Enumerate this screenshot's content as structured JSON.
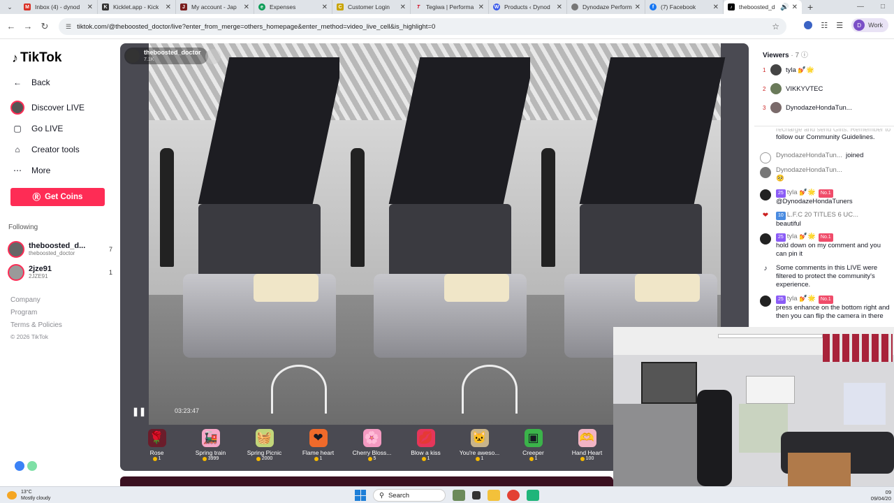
{
  "browser": {
    "tabs": [
      {
        "label": "Inbox (4) - dynod",
        "fav_color": "#d93025",
        "icon": "gmail-icon"
      },
      {
        "label": "Kicklet.app - Kick",
        "fav_color": "#333333",
        "icon": "kicklet-icon"
      },
      {
        "label": "My account - Jap",
        "fav_color": "#7a1d1d",
        "icon": "japan-icon"
      },
      {
        "label": "Expenses",
        "fav_color": "#0f9d58",
        "icon": "expenses-icon"
      },
      {
        "label": "Customer Login",
        "fav_color": "#c9a400",
        "icon": "login-icon"
      },
      {
        "label": "Tegiwa | Performa",
        "fav_color": "#d0021b",
        "icon": "tegiwa-icon"
      },
      {
        "label": "Products ‹ Dynod",
        "fav_color": "#3858e9",
        "icon": "wordpress-icon"
      },
      {
        "label": "Dynodaze Perform",
        "fav_color": "#555555",
        "icon": "globe-icon"
      },
      {
        "label": "(7) Facebook",
        "fav_color": "#1877f2",
        "icon": "facebook-icon"
      },
      {
        "label": "theboosted_d",
        "fav_color": "#000000",
        "icon": "tiktok-icon",
        "active": true
      }
    ],
    "url": "tiktok.com/@theboosted_doctor/live?enter_from_merge=others_homepage&enter_method=video_live_cell&is_highlight=0",
    "profile_initial": "D",
    "profile_name": "Work"
  },
  "sidebar": {
    "logo": "TikTok",
    "nav": [
      {
        "label": "Back",
        "icon": "back-arrow-icon"
      },
      {
        "label": "Discover LIVE",
        "icon": "discover-live-icon"
      },
      {
        "label": "Go LIVE",
        "icon": "camera-icon"
      },
      {
        "label": "Creator tools",
        "icon": "creator-tools-icon"
      },
      {
        "label": "More",
        "icon": "more-icon"
      }
    ],
    "get_coins": "Get Coins",
    "following_label": "Following",
    "following": [
      {
        "name": "theboosted_d...",
        "handle": "theboosted_doctor",
        "count": "7"
      },
      {
        "name": "2jze91",
        "handle": "2JZE91",
        "count": "1"
      }
    ],
    "footer": {
      "company": "Company",
      "program": "Program",
      "terms": "Terms & Policies",
      "copyright": "© 2026 TikTok"
    }
  },
  "video": {
    "streamer": "theboosted_doctor",
    "viewer_count": "7.1K",
    "elapsed": "03:23:47",
    "gifts": [
      {
        "name": "Rose",
        "price": "1",
        "glyph": "🌹",
        "color": "#6b1d2b"
      },
      {
        "name": "Spring train",
        "price": "3999",
        "glyph": "🚂",
        "color": "#f7a7c8"
      },
      {
        "name": "Spring Picnic",
        "price": "2000",
        "glyph": "🧺",
        "color": "#c2d67a"
      },
      {
        "name": "Flame heart",
        "price": "1",
        "glyph": "❤",
        "color": "#f06a2a"
      },
      {
        "name": "Cherry Bloss...",
        "price": "5",
        "glyph": "🌸",
        "color": "#f49ac1"
      },
      {
        "name": "Blow a kiss",
        "price": "1",
        "glyph": "💋",
        "color": "#e5365a"
      },
      {
        "name": "You're aweso...",
        "price": "1",
        "glyph": "🐱",
        "color": "#c9b48a"
      },
      {
        "name": "Creeper",
        "price": "1",
        "glyph": "▣",
        "color": "#3bb34a"
      },
      {
        "name": "Hand Heart",
        "price": "100",
        "glyph": "🫶",
        "color": "#f2b4c4"
      }
    ]
  },
  "viewers": {
    "title": "Viewers",
    "count": "· 7",
    "list": [
      {
        "rank": "1",
        "name": "tyla 💅🌟"
      },
      {
        "rank": "2",
        "name": "VIKKYVTEC"
      },
      {
        "rank": "3",
        "name": "DynodazeHondaTun..."
      }
    ]
  },
  "chat": {
    "notice_cut": "recharge and send Gifts. Remember to",
    "notice_rest": "follow our Community Guidelines.",
    "messages": [
      {
        "user": "DynodazeHondaTun...",
        "text": "joined"
      },
      {
        "user": "DynodazeHondaTun...",
        "text": "🥺"
      },
      {
        "badge": "25",
        "user": "tyla 💅🌟",
        "rank_badge": "No.1",
        "text": "@DynodazeHondaTuners"
      },
      {
        "badge": "10",
        "user": "L.F.C 20 TITLES 6 UC...",
        "text": "beautiful"
      },
      {
        "badge": "25",
        "user": "tyla 💅🌟",
        "rank_badge": "No.1",
        "text": "hold down on my comment and you can pin it"
      },
      {
        "text": "Some comments in this LIVE were filtered to protect the community's experience."
      },
      {
        "badge": "25",
        "user": "tyla 💅🌟",
        "rank_badge": "No.1",
        "text": "press enhance on the bottom right and then you can flip the camera in there"
      }
    ]
  },
  "taskbar": {
    "temperature": "13°C",
    "weather": "Mostly cloudy",
    "search": "Search",
    "time": "09",
    "date": "09/04/20"
  }
}
